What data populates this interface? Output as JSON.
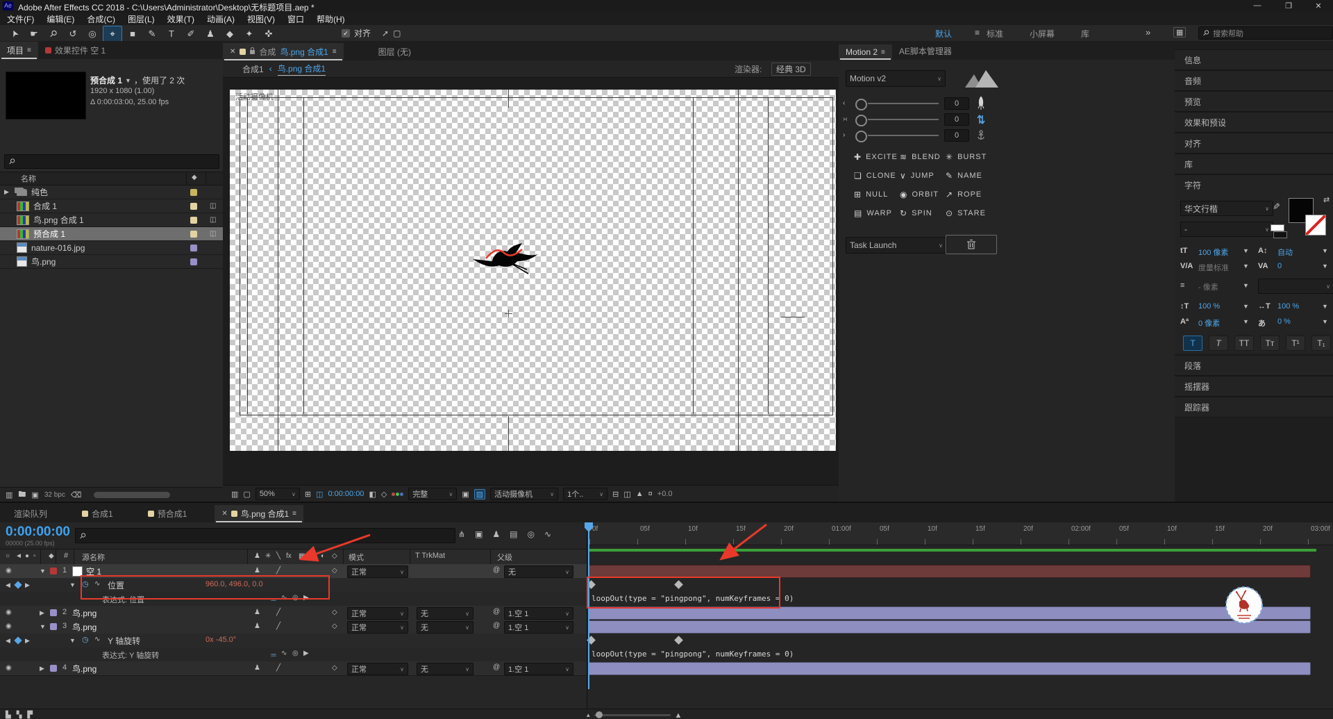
{
  "titlebar": {
    "app_badge": "Ae",
    "title": "Adobe After Effects CC 2018 - C:\\Users\\Administrator\\Desktop\\无标题项目.aep *",
    "window_controls": {
      "minimize": "—",
      "maximize": "❐",
      "close": "✕"
    }
  },
  "menubar": {
    "items": [
      "文件(F)",
      "编辑(E)",
      "合成(C)",
      "图层(L)",
      "效果(T)",
      "动画(A)",
      "视图(V)",
      "窗口",
      "帮助(H)"
    ]
  },
  "toolbar": {
    "tools": [
      "selection",
      "hand",
      "zoom",
      "rotation",
      "orbit-camera",
      "pan-behind",
      "rectangle",
      "pen",
      "type",
      "brush",
      "clone-stamp",
      "eraser",
      "roto-brush",
      "puppet-pin"
    ],
    "active_tool": "pan-behind",
    "snap_label": "对齐",
    "workspace_tabs": [
      "默认",
      "标准",
      "小屏幕",
      "库"
    ],
    "active_workspace": "默认",
    "overflow_label": "»",
    "search_placeholder": "搜索帮助"
  },
  "project_panel": {
    "tabs": [
      {
        "label": "项目",
        "active": true,
        "menu_icon": "≡"
      },
      {
        "label": "效果控件 空 1",
        "chip": "#b53838"
      }
    ],
    "preview_info": {
      "title": "预合成 1",
      "usage": "，使用了 2 次",
      "dimensions": "1920 x 1080 (1.00)",
      "duration": "Δ 0:00:03:00, 25.00 fps"
    },
    "name_column": "名称",
    "items": [
      {
        "name": "纯色",
        "type": "folder",
        "chip": "#c8b560"
      },
      {
        "name": "合成 1",
        "type": "comp",
        "chip": "#e3d3a3"
      },
      {
        "name": "鸟.png 合成 1",
        "type": "comp",
        "chip": "#e3d3a3"
      },
      {
        "name": "预合成 1",
        "type": "comp",
        "chip": "#e3d3a3",
        "selected": true
      },
      {
        "name": "nature-016.jpg",
        "type": "footage",
        "chip": "#9a90c8"
      },
      {
        "name": "鸟.png",
        "type": "footage",
        "chip": "#9a90c8"
      }
    ],
    "footer": {
      "bpc": "32 bpc"
    }
  },
  "viewer": {
    "tab": {
      "comp_prefix": "合成",
      "comp_name": "鸟.png 合成1",
      "menu_icon": "≡"
    },
    "layer_tab": "图层 (无)",
    "breadcrumb": {
      "parent": "合成1",
      "separator": "‹",
      "current": "鸟.png 合成1"
    },
    "renderer_label": "渲染器:",
    "renderer_value": "经典 3D",
    "overlay_label": "活动摄像机",
    "footer": {
      "zoom": "50%",
      "timecode": "0:00:00:00",
      "resolution": "完整",
      "camera": "活动摄像机",
      "view_layout": "1个..",
      "exposure": "+0.0"
    }
  },
  "motion_panel": {
    "tabs": [
      {
        "label": "Motion 2",
        "active": true,
        "menu_icon": "≡"
      },
      {
        "label": "AE脚本管理器"
      }
    ],
    "preset": "Motion v2",
    "sliders": [
      {
        "value": "0"
      },
      {
        "value": "0"
      },
      {
        "value": "0"
      }
    ],
    "buttons": [
      {
        "label": "EXCITE",
        "icon": "plus-icon"
      },
      {
        "label": "BLEND",
        "icon": "blend-icon"
      },
      {
        "label": "BURST",
        "icon": "burst-icon"
      },
      {
        "label": "CLONE",
        "icon": "clone-icon"
      },
      {
        "label": "JUMP",
        "icon": "jump-icon"
      },
      {
        "label": "NAME",
        "icon": "pencil-icon"
      },
      {
        "label": "NULL",
        "icon": "null-icon"
      },
      {
        "label": "ORBIT",
        "icon": "orbit-icon"
      },
      {
        "label": "ROPE",
        "icon": "rope-icon"
      },
      {
        "label": "WARP",
        "icon": "warp-icon"
      },
      {
        "label": "SPIN",
        "icon": "spin-icon"
      },
      {
        "label": "STARE",
        "icon": "eye-icon"
      }
    ],
    "task_dropdown": "Task Launch"
  },
  "sidebar": {
    "collapsed_panels": [
      "信息",
      "音频",
      "预览",
      "效果和预设",
      "对齐",
      "库"
    ],
    "character": {
      "title": "字符",
      "font_family": "华文行楷",
      "font_style": "-",
      "font_size": "100 像素",
      "leading": "自动",
      "kerning": "度量标准",
      "tracking": "0",
      "stroke_width": "- 像素",
      "vertical_scale": "100 %",
      "horizontal_scale": "100 %",
      "baseline_shift": "0 像素",
      "tsume": "0 %",
      "toggles": [
        "T",
        "T",
        "TT",
        "Tᴛ",
        "T¹",
        "T₁"
      ]
    },
    "bottom_panels": [
      "段落",
      "摇摆器",
      "跟踪器"
    ]
  },
  "timeline": {
    "tabs": [
      {
        "label": "渲染队列"
      },
      {
        "label": "合成1",
        "chip": "#e3d3a3"
      },
      {
        "label": "预合成1",
        "chip": "#e3d3a3"
      },
      {
        "label": "鸟.png 合成1",
        "chip": "#e3d3a3",
        "active": true,
        "closable": true,
        "menu_icon": "≡"
      }
    ],
    "timecode": "0:00:00:00",
    "timecode_sub": "00000 (25.00 fps)",
    "columns": {
      "num": "#",
      "source": "源名称",
      "mode": "模式",
      "trkmat": "T TrkMat",
      "parent": "父级"
    },
    "ruler_ticks": [
      "0f",
      "05f",
      "10f",
      "15f",
      "20f",
      "01:00f",
      "05f",
      "10f",
      "15f",
      "20f",
      "02:00f",
      "05f",
      "10f",
      "15f",
      "20f",
      "03:00f"
    ],
    "layers": [
      {
        "num": "1",
        "name": "空 1",
        "chip": "#b53838",
        "solid": "#ffffff",
        "expanded": true,
        "mode": "正常",
        "parent": "无",
        "bar": "#6e3a3a",
        "property": {
          "name": "位置",
          "value": "960.0, 496.0, 0.0"
        },
        "expression": {
          "label": "表达式: 位置",
          "code": "loopOut(type = \"pingpong\", numKeyframes = 0)"
        }
      },
      {
        "num": "2",
        "name": "鸟.png",
        "chip": "#9a90c8",
        "mode": "正常",
        "trkmat": "无",
        "parent": "1.空 1",
        "bar": "#8e8ec0"
      },
      {
        "num": "3",
        "name": "鸟.png",
        "chip": "#9a90c8",
        "expanded": true,
        "mode": "正常",
        "trkmat": "无",
        "parent": "1.空 1",
        "bar": "#8e8ec0",
        "property": {
          "name": "Y 轴旋转",
          "value": "0x -45.0°"
        },
        "expression": {
          "label": "表达式: Y 轴旋转",
          "code": "loopOut(type = \"pingpong\", numKeyframes = 0)"
        }
      },
      {
        "num": "4",
        "name": "鸟.png",
        "chip": "#9a90c8",
        "mode": "正常",
        "trkmat": "无",
        "parent": "1.空 1",
        "bar": "#8e8ec0"
      }
    ]
  },
  "colors": {
    "accent": "#4ea6ea",
    "annotation": "#e8392b",
    "work_area_green": "#3c9e38",
    "value_red": "#cf6a5a",
    "label_cream": "#e3d3a3",
    "label_purple": "#9a90c8"
  }
}
